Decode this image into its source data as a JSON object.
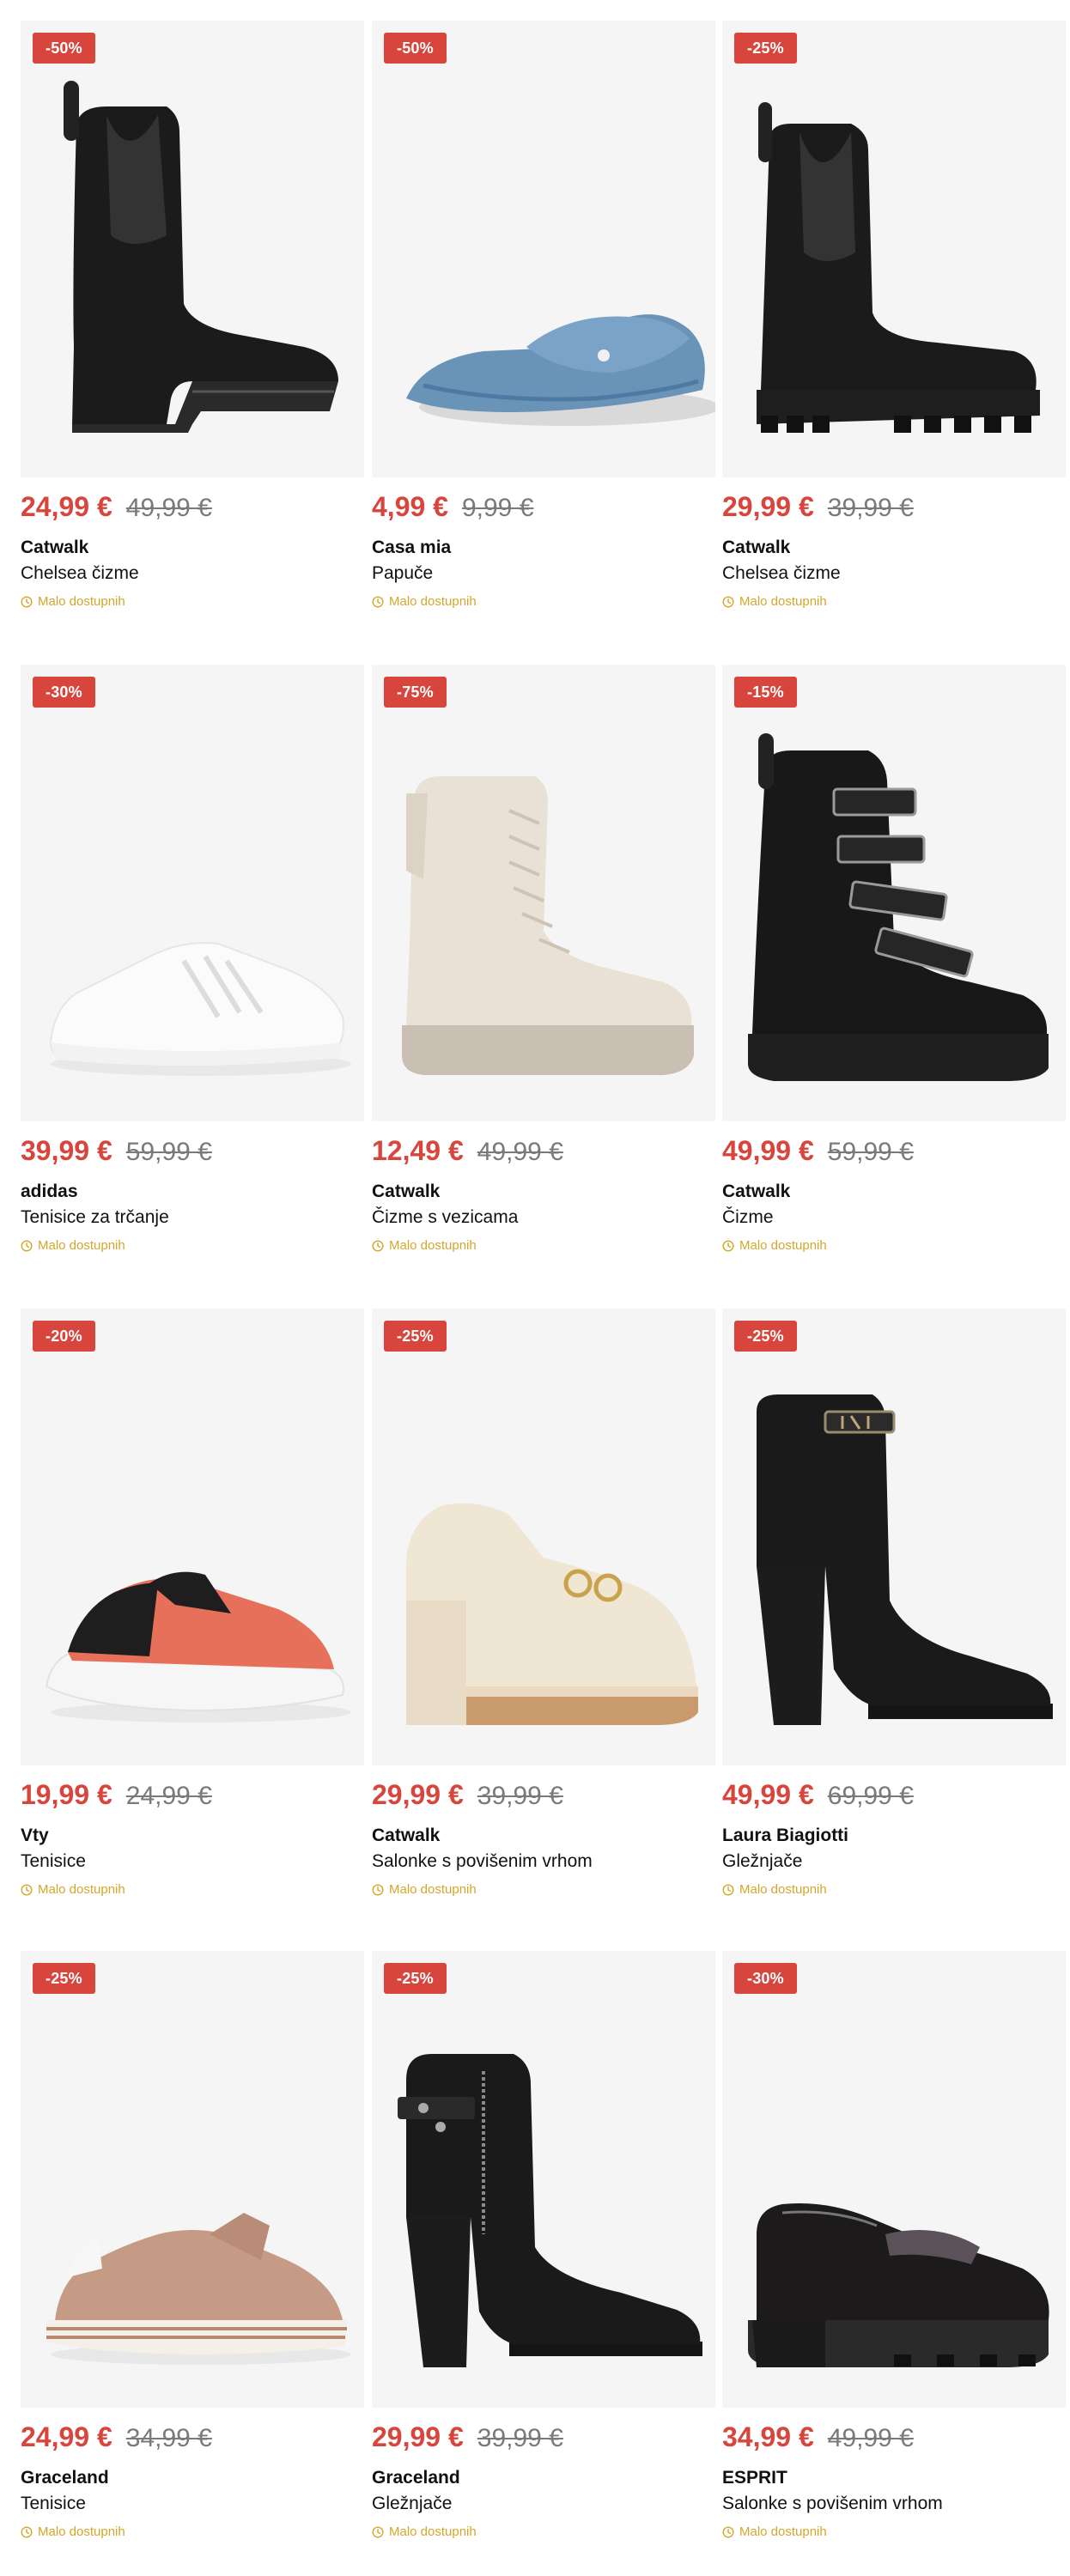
{
  "products": [
    {
      "badge": "-50%",
      "price": "24,99 €",
      "old_price": "49,99 €",
      "brand": "Catwalk",
      "name": "Chelsea čizme",
      "stock": "Malo dostupnih",
      "icon": "black-chelsea-boot-icon"
    },
    {
      "badge": "-50%",
      "price": "4,99 €",
      "old_price": "9,99 €",
      "brand": "Casa mia",
      "name": "Papuče",
      "stock": "Malo dostupnih",
      "icon": "blue-slipper-icon"
    },
    {
      "badge": "-25%",
      "price": "29,99 €",
      "old_price": "39,99 €",
      "brand": "Catwalk",
      "name": "Chelsea čizme",
      "stock": "Malo dostupnih",
      "icon": "black-chunky-chelsea-boot-icon"
    },
    {
      "badge": "-30%",
      "price": "39,99 €",
      "old_price": "59,99 €",
      "brand": "adidas",
      "name": "Tenisice za trčanje",
      "stock": "Malo dostupnih",
      "icon": "white-running-shoe-icon"
    },
    {
      "badge": "-75%",
      "price": "12,49 €",
      "old_price": "49,99 €",
      "brand": "Catwalk",
      "name": "Čizme s vezicama",
      "stock": "Malo dostupnih",
      "icon": "beige-lace-up-boot-icon"
    },
    {
      "badge": "-15%",
      "price": "49,99 €",
      "old_price": "59,99 €",
      "brand": "Catwalk",
      "name": "Čizme",
      "stock": "Malo dostupnih",
      "icon": "black-buckle-boot-icon"
    },
    {
      "badge": "-20%",
      "price": "19,99 €",
      "old_price": "24,99 €",
      "brand": "Vty",
      "name": "Tenisice",
      "stock": "Malo dostupnih",
      "icon": "coral-sneaker-icon"
    },
    {
      "badge": "-25%",
      "price": "29,99 €",
      "old_price": "39,99 €",
      "brand": "Catwalk",
      "name": "Salonke s povišenim vrhom",
      "stock": "Malo dostupnih",
      "icon": "cream-platform-loafer-icon"
    },
    {
      "badge": "-25%",
      "price": "49,99 €",
      "old_price": "69,99 €",
      "brand": "Laura Biagiotti",
      "name": "Gležnjače",
      "stock": "Malo dostupnih",
      "icon": "black-heeled-ankle-boot-icon"
    },
    {
      "badge": "-25%",
      "price": "24,99 €",
      "old_price": "34,99 €",
      "brand": "Graceland",
      "name": "Tenisice",
      "stock": "Malo dostupnih",
      "icon": "rose-gold-sneaker-icon"
    },
    {
      "badge": "-25%",
      "price": "29,99 €",
      "old_price": "39,99 €",
      "brand": "Graceland",
      "name": "Gležnjače",
      "stock": "Malo dostupnih",
      "icon": "black-zip-ankle-boot-icon"
    },
    {
      "badge": "-30%",
      "price": "34,99 €",
      "old_price": "49,99 €",
      "brand": "ESPRIT",
      "name": "Salonke s povišenim vrhom",
      "stock": "Malo dostupnih",
      "icon": "patent-platform-loafer-icon"
    }
  ],
  "colors": {
    "sale": "#d8453c",
    "old_price": "#7a7a7a",
    "stock": "#d4a72c",
    "tile_bg": "#f5f5f5"
  }
}
